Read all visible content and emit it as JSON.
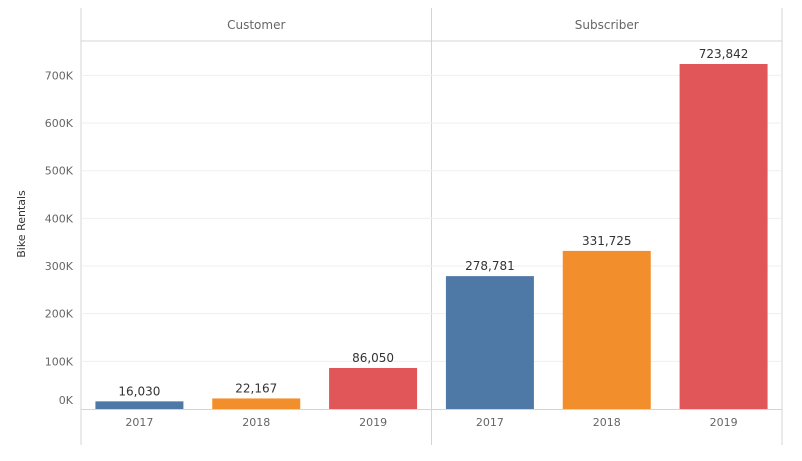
{
  "chart_data": {
    "type": "bar",
    "ylabel": "Bike Rentals",
    "ylim": [
      0,
      770000
    ],
    "yticks": [
      0,
      100000,
      200000,
      300000,
      400000,
      500000,
      600000,
      700000
    ],
    "ytick_labels": [
      "0K",
      "100K",
      "200K",
      "300K",
      "400K",
      "500K",
      "600K",
      "700K"
    ],
    "grid": true,
    "colors": {
      "2017": "#4e79a7",
      "2018": "#f28e2b",
      "2019": "#e15759"
    },
    "panels": [
      {
        "title": "Customer",
        "categories": [
          "2017",
          "2018",
          "2019"
        ],
        "values": [
          16030,
          22167,
          86050
        ],
        "value_labels": [
          "16,030",
          "22,167",
          "86,050"
        ]
      },
      {
        "title": "Subscriber",
        "categories": [
          "2017",
          "2018",
          "2019"
        ],
        "values": [
          278781,
          331725,
          723842
        ],
        "value_labels": [
          "278,781",
          "331,725",
          "723,842"
        ]
      }
    ]
  }
}
